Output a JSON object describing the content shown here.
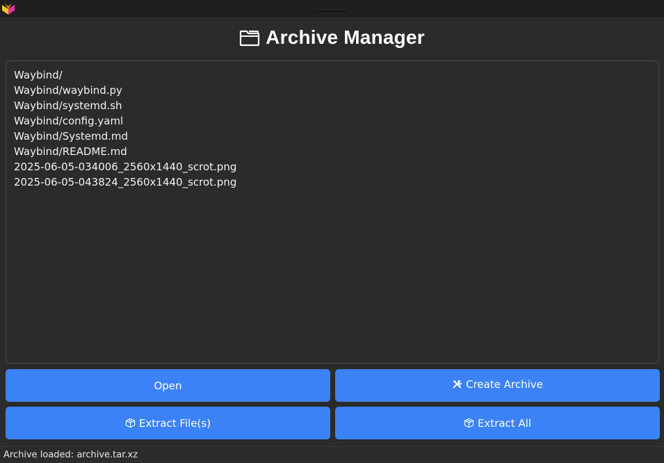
{
  "titlebar": {
    "app_icon": "app-logo-icon"
  },
  "header": {
    "icon": "folder-icon",
    "title": "Archive Manager"
  },
  "file_list": {
    "items": [
      "Waybind/",
      "Waybind/waybind.py",
      "Waybind/systemd.sh",
      "Waybind/config.yaml",
      "Waybind/Systemd.md",
      "Waybind/README.md",
      "2025-06-05-034006_2560x1440_scrot.png",
      "2025-06-05-043824_2560x1440_scrot.png"
    ]
  },
  "buttons": {
    "open": {
      "label": "Open"
    },
    "create_archive": {
      "icon": "tools-icon",
      "label": "Create Archive"
    },
    "extract_files": {
      "icon": "package-icon",
      "label": "Extract File(s)"
    },
    "extract_all": {
      "icon": "package-icon",
      "label": "Extract All"
    }
  },
  "status_bar": {
    "text": "Archive loaded: archive.tar.xz"
  },
  "colors": {
    "background": "#2b2b2b",
    "titlebar": "#1f1f1f",
    "button": "#3b82f6",
    "text": "#ffffff"
  }
}
